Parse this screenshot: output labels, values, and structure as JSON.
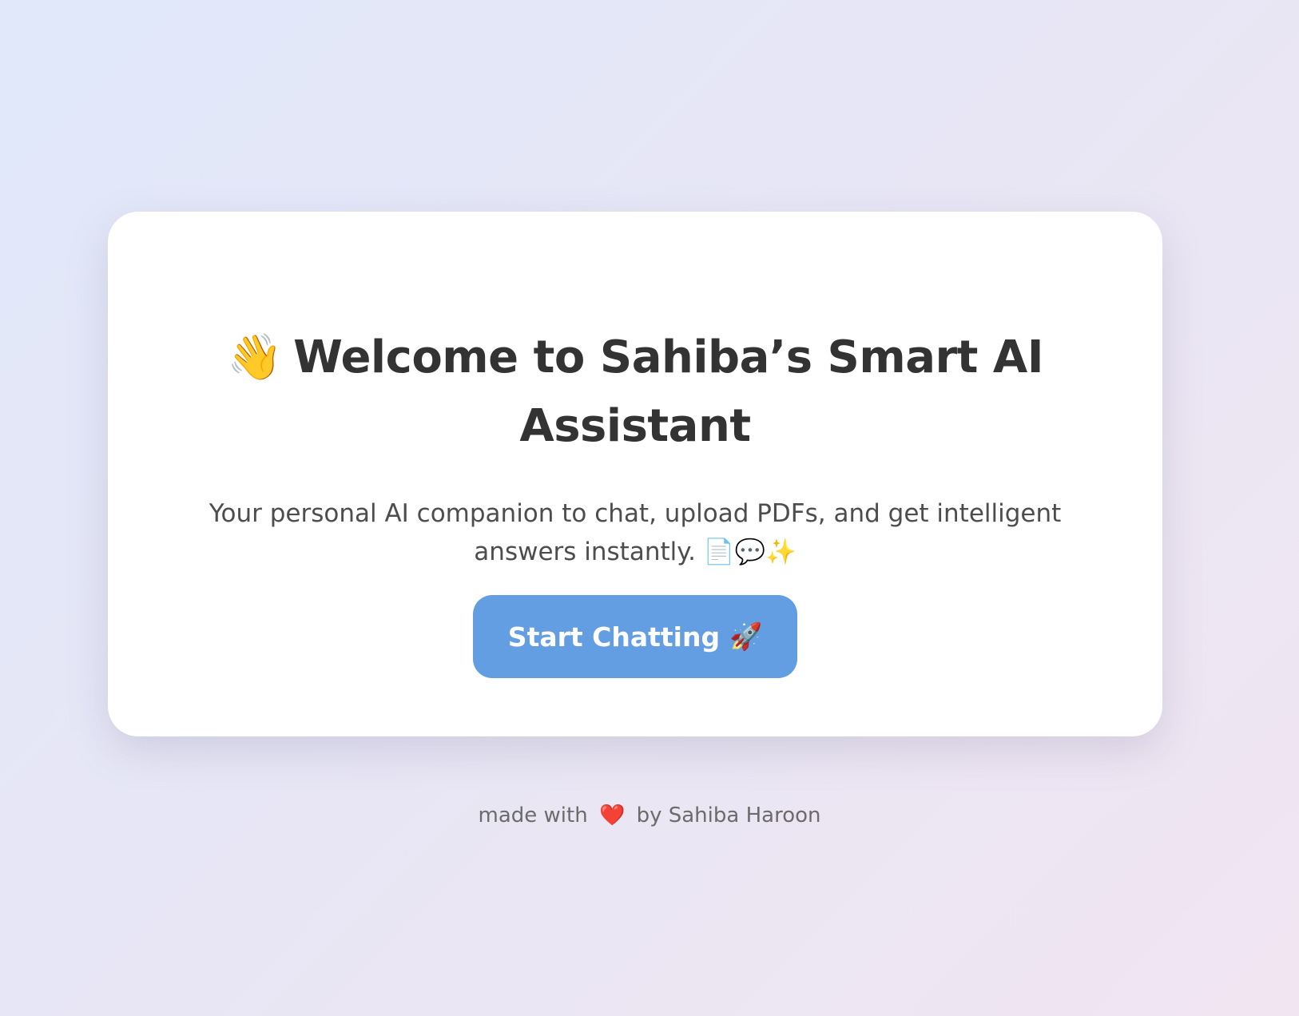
{
  "welcome": {
    "icon": "waving-hand-icon",
    "icon_glyph": "👋",
    "title": "Welcome to Sahiba’s Smart AI Assistant",
    "subtitle": "Your personal AI companion to chat, upload PDFs, and get intelligent answers instantly. 📄💬✨",
    "button_label": "Start Chatting",
    "button_icon": "rocket-icon",
    "button_icon_glyph": "🚀",
    "button_color": "#649ee2"
  },
  "footer": {
    "prefix": "made with",
    "heart_icon": "heart-icon",
    "heart_glyph": "❤️",
    "suffix": "by Sahiba Haroon"
  }
}
